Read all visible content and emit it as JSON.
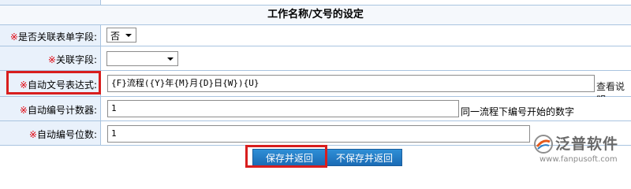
{
  "form": {
    "section_title": "工作名称/文号的设定",
    "required_mark": "※",
    "rows": [
      {
        "label": "是否关联表单字段:",
        "select_value": "否"
      },
      {
        "label": "关联字段:",
        "select_value": ""
      },
      {
        "label": "自动文号表达式:",
        "input_value": "{F}流程({Y}年{M}月{D}日{W}){U}",
        "hint": "查看说明"
      },
      {
        "label": "自动编号计数器:",
        "input_value": "1",
        "hint": "同一流程下编号开始的数字"
      },
      {
        "label": "自动编号位数:",
        "input_value": "1"
      }
    ]
  },
  "buttons": {
    "save": "保存并返回",
    "nosave": "不保存并返回"
  },
  "logo": {
    "name": "泛普软件",
    "url": "www.fanpusoft.com"
  },
  "colors": {
    "label_bg": "#e9f1fb",
    "border": "#a9c4e0",
    "required": "#e0000b",
    "highlight": "#d81e1e",
    "button": "#1f78c4"
  }
}
